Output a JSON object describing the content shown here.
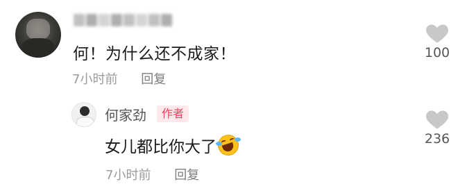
{
  "comment": {
    "username": "",
    "text": "何！为什么还不成家！",
    "time": "7小时前",
    "reply_label": "回复",
    "like_count": "100"
  },
  "reply": {
    "author_name": "何家劲",
    "author_badge": "作者",
    "text": "女儿都比你大了",
    "emoji": "rofl-emoji",
    "time": "7小时前",
    "reply_label": "回复",
    "like_count": "236"
  },
  "colors": {
    "badge_text": "#f0435f",
    "badge_bg": "#fde9ec",
    "meta_text": "#9b9b9b",
    "heart": "#c8c8c8"
  }
}
